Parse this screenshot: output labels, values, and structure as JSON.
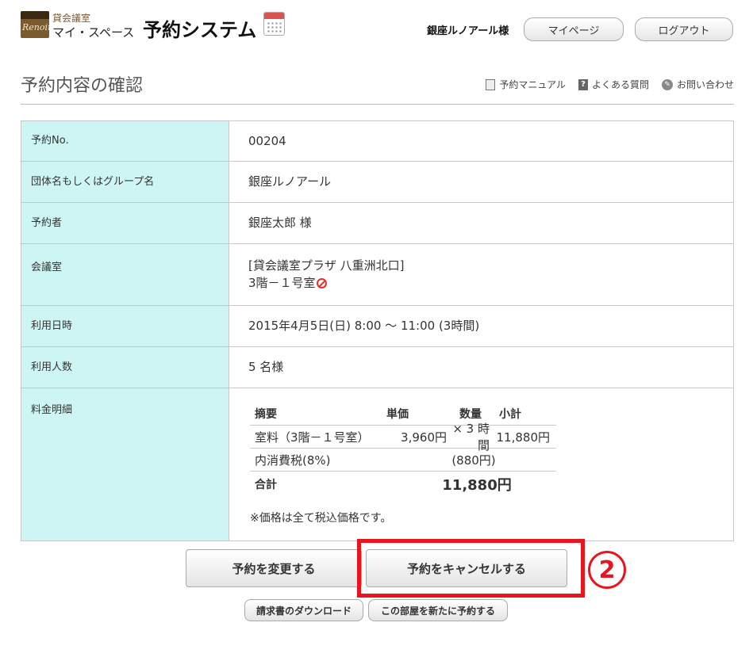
{
  "header": {
    "logo_text": "Renoir",
    "brand_top": "貸会議室",
    "brand_bottom": "マイ・スペース",
    "system_title": "予約システム",
    "user_name": "銀座ルノアール様",
    "mypage_label": "マイページ",
    "logout_label": "ログアウト"
  },
  "page": {
    "title": "予約内容の確認",
    "help_links": [
      {
        "label": "予約マニュアル",
        "icon": "manual-icon"
      },
      {
        "label": "よくある質問",
        "icon": "faq-icon"
      },
      {
        "label": "お問い合わせ",
        "icon": "contact-icon"
      }
    ]
  },
  "reservation": {
    "no_label": "予約No.",
    "no_value": "00204",
    "group_label": "団体名もしくはグループ名",
    "group_value": "銀座ルノアール",
    "booker_label": "予約者",
    "booker_value": "銀座太郎 様",
    "room_label": "会議室",
    "room_line1": "[貸会議室プラザ 八重洲北口]",
    "room_line2": "3階－１号室",
    "datetime_label": "利用日時",
    "datetime_value": "2015年4月5日(日) 8:00 ～ 11:00 (3時間)",
    "people_label": "利用人数",
    "people_value": "5 名様",
    "fee_label": "料金明細"
  },
  "fee": {
    "headers": {
      "summary": "摘要",
      "unit_price": "単価",
      "quantity": "数量",
      "subtotal": "小計"
    },
    "room_row": {
      "summary": "室料（3階－１号室）",
      "unit_price": "3,960円",
      "quantity": "× 3 時間",
      "subtotal": "11,880円"
    },
    "tax_row": {
      "summary": "内消費税(8%)",
      "value": "(880円)"
    },
    "total_row": {
      "summary": "合計",
      "value": "11,880円"
    },
    "note": "※価格は全て税込価格です。"
  },
  "actions": {
    "change_label": "予約を変更する",
    "cancel_label": "予約をキャンセルする",
    "step_marker": "2",
    "invoice_label": "請求書のダウンロード",
    "rebook_label": "この部屋を新たに予約する"
  },
  "colors": {
    "label_bg": "#cdf5f3",
    "highlight": "#e8151f",
    "brand": "#7a5a2f"
  }
}
